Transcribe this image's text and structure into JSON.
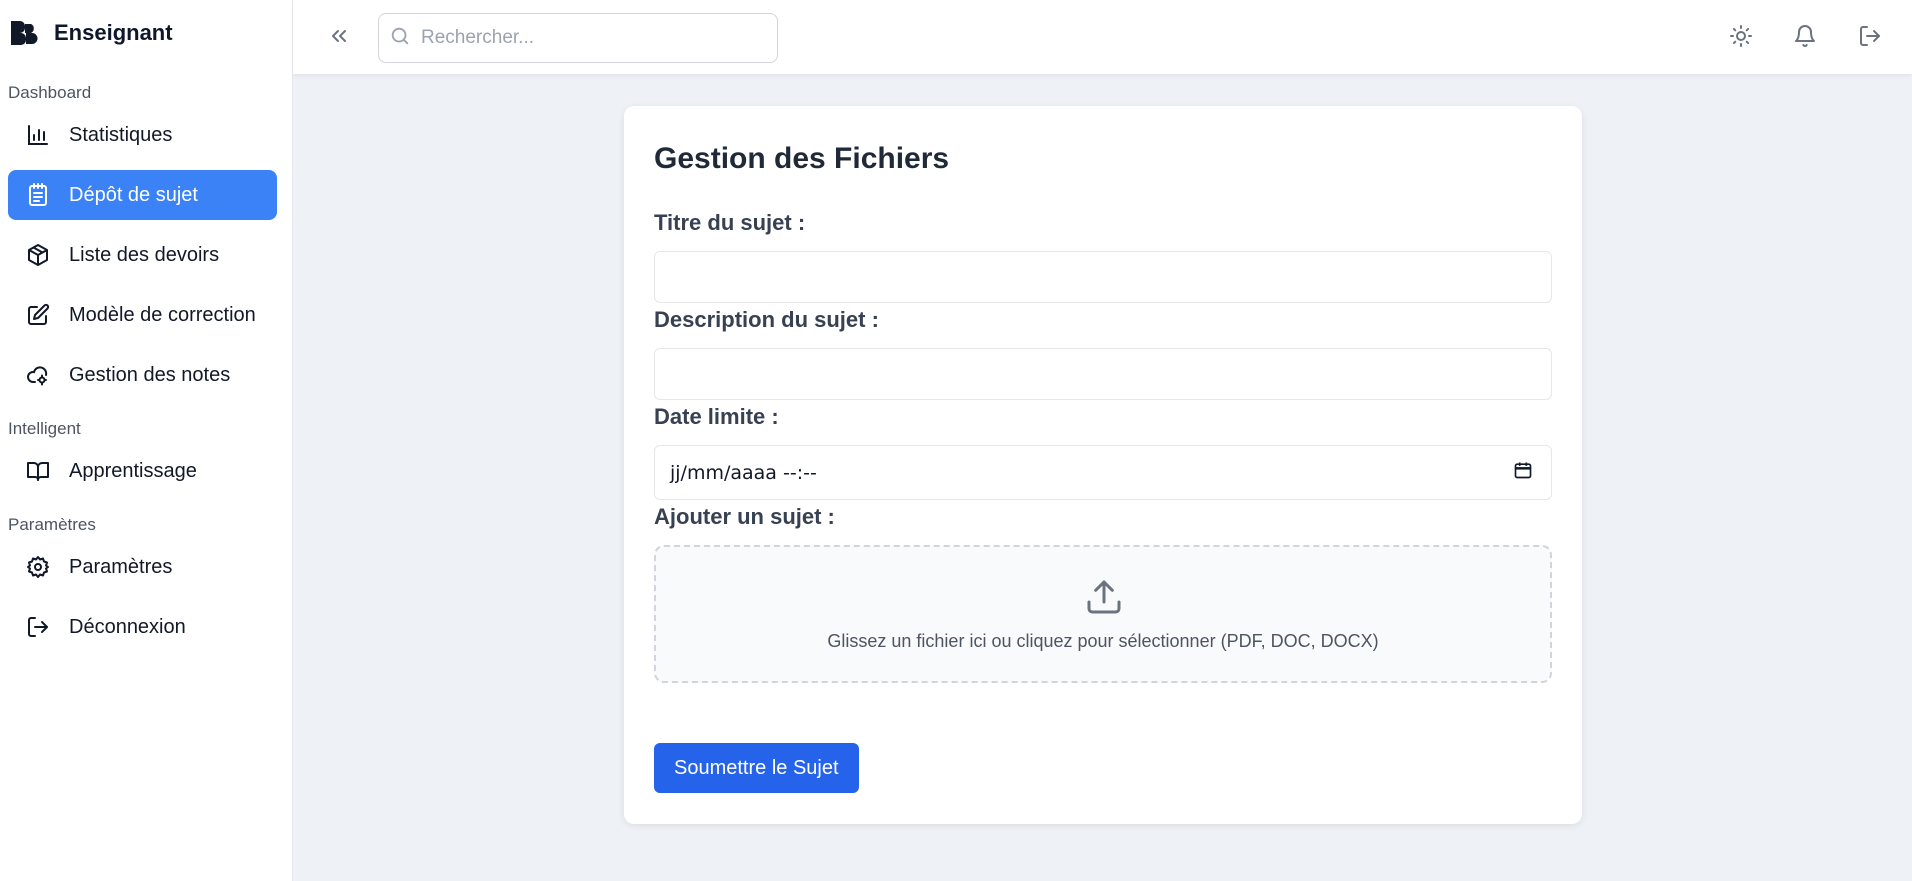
{
  "app": {
    "title": "Enseignant"
  },
  "sidebar": {
    "sections": [
      {
        "label": "Dashboard"
      },
      {
        "label": "Intelligent"
      },
      {
        "label": "Paramètres"
      }
    ],
    "items": [
      {
        "label": "Statistiques",
        "icon": "bar-chart-icon"
      },
      {
        "label": "Dépôt de sujet",
        "icon": "clipboard-icon",
        "active": true
      },
      {
        "label": "Liste des devoirs",
        "icon": "package-icon"
      },
      {
        "label": "Modèle de correction",
        "icon": "edit-icon"
      },
      {
        "label": "Gestion des notes",
        "icon": "cloud-cog-icon"
      },
      {
        "label": "Apprentissage",
        "icon": "book-icon"
      },
      {
        "label": "Paramètres",
        "icon": "gear-icon"
      },
      {
        "label": "Déconnexion",
        "icon": "logout-icon"
      }
    ]
  },
  "header": {
    "search_placeholder": "Rechercher..."
  },
  "form": {
    "title": "Gestion des Fichiers",
    "subject_title_label": "Titre du sujet :",
    "subject_title_value": "",
    "description_label": "Description du sujet :",
    "description_value": "",
    "deadline_label": "Date limite :",
    "deadline_placeholder": "jj/mm/aaaa --:--",
    "upload_label": "Ajouter un sujet :",
    "upload_hint": "Glissez un fichier ici ou cliquez pour sélectionner (PDF, DOC, DOCX)",
    "submit_label": "Soumettre le Sujet"
  },
  "colors": {
    "accent": "#3b82f6",
    "submit": "#2563eb",
    "background": "#eef1f6"
  }
}
